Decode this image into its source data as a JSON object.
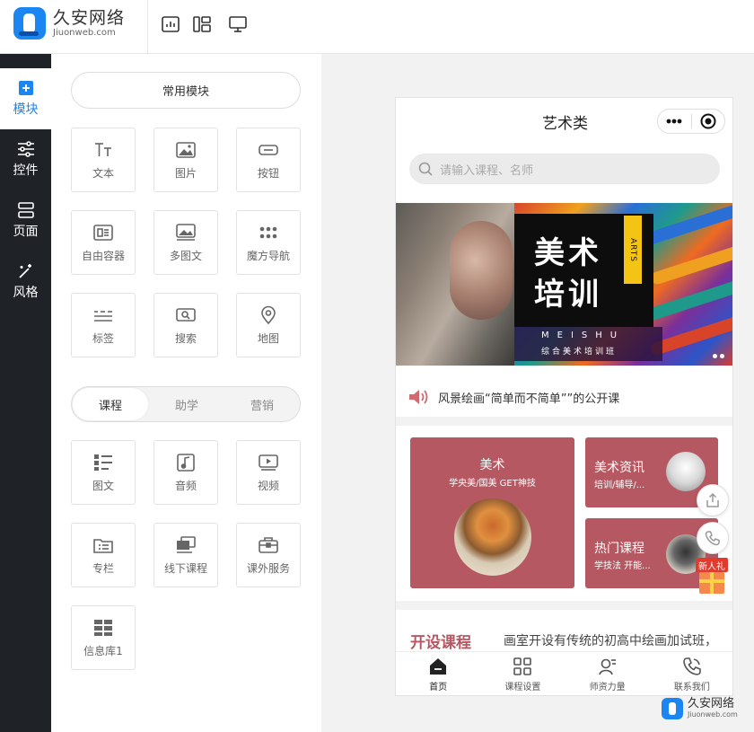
{
  "brand": {
    "name_cn": "久安网络",
    "name_en": "Jiuonweb.com",
    "color": "#1b86f2"
  },
  "toolbar": {
    "icons": [
      "stats-icon",
      "layout-icon",
      "monitor-icon"
    ]
  },
  "sidebar": {
    "items": [
      {
        "label": "模块",
        "icon": "plus-square-icon",
        "active": true
      },
      {
        "label": "控件",
        "icon": "sliders-icon",
        "active": false
      },
      {
        "label": "页面",
        "icon": "pages-icon",
        "active": false
      },
      {
        "label": "风格",
        "icon": "magic-wand-icon",
        "active": false
      }
    ]
  },
  "panel": {
    "common_title": "常用模块",
    "common_modules": [
      {
        "label": "文本",
        "icon": "text-icon"
      },
      {
        "label": "图片",
        "icon": "image-icon"
      },
      {
        "label": "按钮",
        "icon": "button-icon"
      },
      {
        "label": "自由容器",
        "icon": "container-icon"
      },
      {
        "label": "多图文",
        "icon": "multi-image-icon"
      },
      {
        "label": "魔方导航",
        "icon": "grid-dots-icon"
      },
      {
        "label": "标签",
        "icon": "tag-lines-icon"
      },
      {
        "label": "搜索",
        "icon": "search-box-icon"
      },
      {
        "label": "地图",
        "icon": "map-pin-icon"
      }
    ],
    "tabs": [
      {
        "label": "课程",
        "active": true
      },
      {
        "label": "助学",
        "active": false
      },
      {
        "label": "营销",
        "active": false
      }
    ],
    "course_modules": [
      {
        "label": "图文",
        "icon": "list-image-icon"
      },
      {
        "label": "音频",
        "icon": "audio-icon"
      },
      {
        "label": "视频",
        "icon": "video-icon"
      },
      {
        "label": "专栏",
        "icon": "folder-list-icon"
      },
      {
        "label": "线下课程",
        "icon": "offline-course-icon"
      },
      {
        "label": "课外服务",
        "icon": "briefcase-icon"
      },
      {
        "label": "信息库1",
        "icon": "grid-table-icon"
      }
    ]
  },
  "phone": {
    "title": "艺术类",
    "search_placeholder": "请输入课程、名师",
    "banner": {
      "title_line1": "美术",
      "title_line2": "培训",
      "tag": "ARTS",
      "sub_en": "MEISHU",
      "sub_cn": "综合美术培训班"
    },
    "notice": "风景绘画“简单而不简单””的公开课",
    "cards": {
      "main": {
        "title": "美术",
        "subtitle": "学央美/国美 GET神技"
      },
      "top_right": {
        "title": "美术资讯",
        "subtitle": "培训/辅导/..."
      },
      "bottom_right": {
        "title": "热门课程",
        "subtitle": "学技法 开能..."
      },
      "accent": "#b65862"
    },
    "section": {
      "title": "开设课程",
      "desc": "画室开设有传统的初高中绘画加试班，"
    },
    "gift_label": "新人礼",
    "tabbar": [
      {
        "label": "首页",
        "icon": "home-icon",
        "active": true
      },
      {
        "label": "课程设置",
        "icon": "grid-four-icon",
        "active": false
      },
      {
        "label": "师资力量",
        "icon": "teacher-icon",
        "active": false
      },
      {
        "label": "联系我们",
        "icon": "phone-icon",
        "active": false
      }
    ]
  },
  "watermark": {
    "name_cn": "久安网络",
    "name_en": "Jiuonweb.com"
  }
}
